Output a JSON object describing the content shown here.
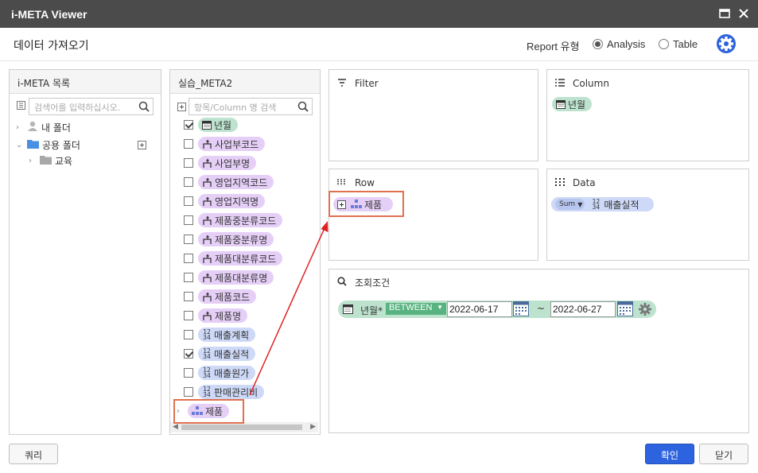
{
  "window": {
    "title": "i-META Viewer"
  },
  "header": {
    "title": "데이터 가져오기",
    "report_type_label": "Report 유형",
    "options": [
      "Analysis",
      "Table"
    ],
    "selected": "Analysis"
  },
  "left_panel": {
    "title": "i-META 목록",
    "search_placeholder": "검색어를 입력하십시오.",
    "tree": [
      {
        "label": "내 폴더"
      },
      {
        "label": "공용 폴더"
      },
      {
        "label": "교육"
      }
    ]
  },
  "meta_panel": {
    "title": "실습_META2",
    "search_placeholder": "항목/Column 명 검색",
    "items": [
      {
        "label": "년월",
        "type": "time",
        "checked": true
      },
      {
        "label": "사업부코드",
        "type": "dim",
        "checked": false
      },
      {
        "label": "사업부명",
        "type": "dim",
        "checked": false
      },
      {
        "label": "영업지역코드",
        "type": "dim",
        "checked": false
      },
      {
        "label": "영업지역명",
        "type": "dim",
        "checked": false
      },
      {
        "label": "제품중분류코드",
        "type": "dim",
        "checked": false
      },
      {
        "label": "제품중분류명",
        "type": "dim",
        "checked": false
      },
      {
        "label": "제품대분류코드",
        "type": "dim",
        "checked": false
      },
      {
        "label": "제품대분류명",
        "type": "dim",
        "checked": false
      },
      {
        "label": "제품코드",
        "type": "dim",
        "checked": false
      },
      {
        "label": "제품명",
        "type": "dim",
        "checked": false
      },
      {
        "label": "매출계획",
        "type": "mea",
        "checked": false
      },
      {
        "label": "매출실적",
        "type": "mea",
        "checked": true
      },
      {
        "label": "매출원가",
        "type": "mea",
        "checked": false
      },
      {
        "label": "판매관리비",
        "type": "mea",
        "checked": false
      }
    ],
    "hierarchy_item": "제품"
  },
  "zones": {
    "filter": {
      "title": "Filter"
    },
    "column": {
      "title": "Column",
      "items": [
        "년월"
      ]
    },
    "row": {
      "title": "Row",
      "items": [
        "제품"
      ]
    },
    "data": {
      "title": "Data",
      "items": [
        {
          "agg": "Sum",
          "label": "매출실적"
        }
      ]
    }
  },
  "condition": {
    "title": "조회조건",
    "field": "년월*",
    "operator": "BETWEEN",
    "from": "2022-06-17",
    "tilde": "~",
    "to": "2022-06-27"
  },
  "footer": {
    "query_button": "쿼리",
    "ok_button": "확인",
    "close_button": "닫기"
  },
  "colors": {
    "accent": "#2d63de",
    "dimension": "#e6cff7",
    "measure": "#cdd9f7",
    "time": "#bde3cf",
    "annotation": "#e02020"
  }
}
